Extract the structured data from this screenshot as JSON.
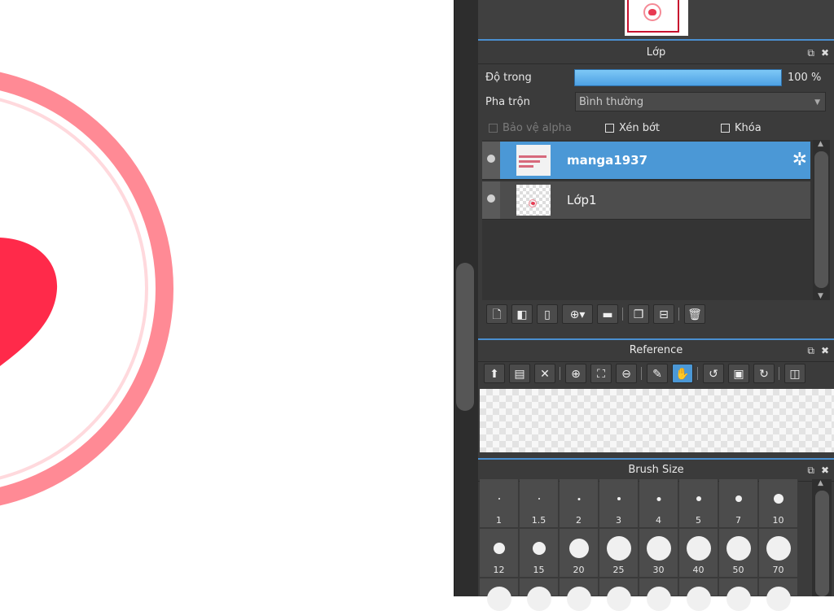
{
  "layer_panel": {
    "title": "Lớp",
    "opacity_label": "Độ trong",
    "opacity_value": "100 %",
    "opacity_level": 1.0,
    "blend_label": "Pha trộn",
    "blend_value": "Bình thường",
    "protect_alpha": "Bảo vệ alpha",
    "clipping": "Xén bớt",
    "lock": "Khóa",
    "layers": [
      {
        "name": "manga1937",
        "selected": true
      },
      {
        "name": "Lớp1",
        "selected": false
      }
    ]
  },
  "reference_panel": {
    "title": "Reference"
  },
  "brush_panel": {
    "title": "Brush Size",
    "sizes": [
      "1",
      "1.5",
      "2",
      "3",
      "4",
      "5",
      "7",
      "10",
      "12",
      "15",
      "20",
      "25",
      "30",
      "40",
      "50",
      "70"
    ]
  },
  "colors": {
    "accent": "#4b98d6",
    "ring": "#ff8a94",
    "heart": "#ff2a4a"
  }
}
